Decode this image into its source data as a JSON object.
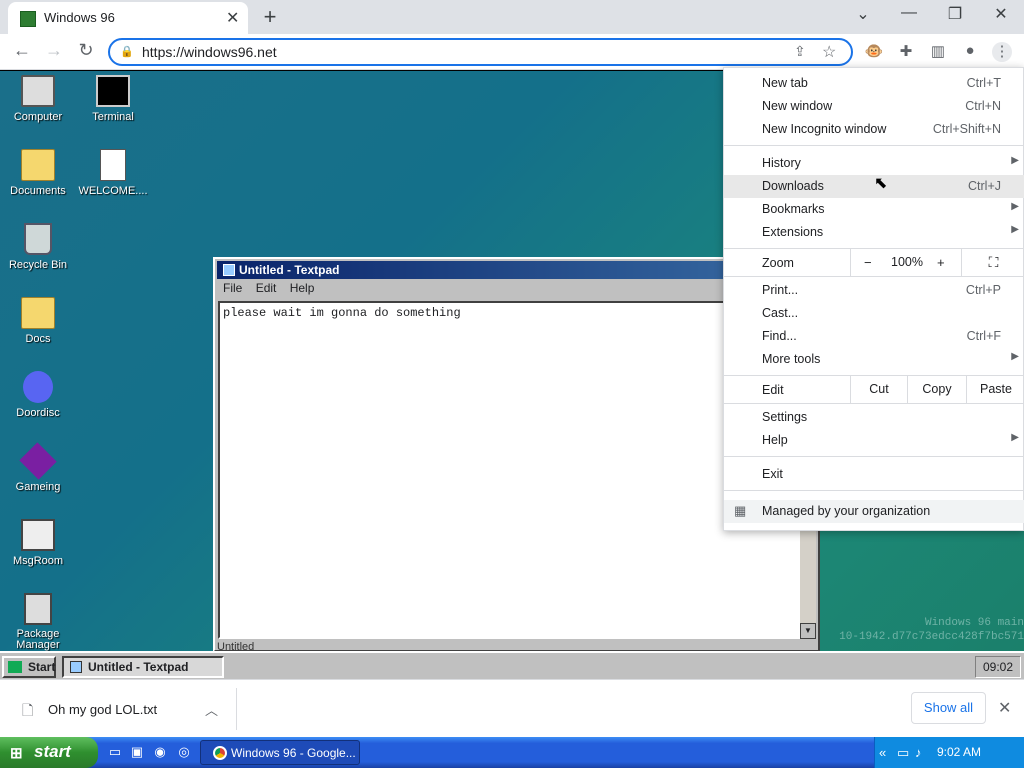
{
  "browser": {
    "tab_title": "Windows 96",
    "tab_close": "✕",
    "new_tab": "+",
    "window_controls": {
      "dropdown": "⌄",
      "minimize": "—",
      "restore": "❐",
      "close": "✕"
    },
    "url": "https://windows96.net",
    "icons": [
      "back-icon",
      "forward-icon",
      "reload-icon",
      "lock-icon",
      "share-icon",
      "star-icon",
      "extension-monkey-icon",
      "puzzle-icon",
      "sidepanel-icon",
      "profile-icon",
      "kebab-menu-icon"
    ]
  },
  "chrome_menu": {
    "new_tab": {
      "label": "New tab",
      "shortcut": "Ctrl+T"
    },
    "new_window": {
      "label": "New window",
      "shortcut": "Ctrl+N"
    },
    "new_incognito": {
      "label": "New Incognito window",
      "shortcut": "Ctrl+Shift+N"
    },
    "history": {
      "label": "History"
    },
    "downloads": {
      "label": "Downloads",
      "shortcut": "Ctrl+J"
    },
    "bookmarks": {
      "label": "Bookmarks"
    },
    "extensions": {
      "label": "Extensions"
    },
    "zoom": {
      "label": "Zoom",
      "minus": "−",
      "value": "100%",
      "plus": "+"
    },
    "print": {
      "label": "Print...",
      "shortcut": "Ctrl+P"
    },
    "cast": {
      "label": "Cast..."
    },
    "find": {
      "label": "Find...",
      "shortcut": "Ctrl+F"
    },
    "more_tools": {
      "label": "More tools"
    },
    "edit": {
      "label": "Edit",
      "cut": "Cut",
      "copy": "Copy",
      "paste": "Paste"
    },
    "settings": {
      "label": "Settings"
    },
    "help": {
      "label": "Help"
    },
    "exit": {
      "label": "Exit"
    },
    "managed": {
      "label": "Managed by your organization"
    }
  },
  "desktop": {
    "icons": [
      {
        "label": "Computer",
        "icon": "computer-icon"
      },
      {
        "label": "Terminal",
        "icon": "terminal-icon"
      },
      {
        "label": "Documents",
        "icon": "documents-folder-icon"
      },
      {
        "label": "WELCOME....",
        "icon": "markdown-file-icon"
      },
      {
        "label": "Recycle Bin",
        "icon": "recycle-bin-icon"
      },
      {
        "label": "Docs",
        "icon": "folder-icon"
      },
      {
        "label": "Doordisc",
        "icon": "doordisc-icon"
      },
      {
        "label": "Gameing",
        "icon": "cube-icon"
      },
      {
        "label": "MsgRoom",
        "icon": "msgroom-icon"
      },
      {
        "label": "Package Manager",
        "icon": "package-icon"
      }
    ],
    "watermark_line1": "Windows 96 main",
    "watermark_line2": "10-1942.d77c73edcc428f7bc571"
  },
  "textpad": {
    "title": "Untitled - Textpad",
    "menu": [
      "File",
      "Edit",
      "Help"
    ],
    "content": "please wait im gonna do something",
    "status": "Untitled"
  },
  "w96_taskbar": {
    "start": "Start",
    "task": "Untitled - Textpad",
    "clock": "09:02"
  },
  "download_bar": {
    "file_name": "Oh my god LOL.txt",
    "show_all": "Show all"
  },
  "xp_taskbar": {
    "start": "start",
    "window": "Windows 96 - Google...",
    "clock": "9:02 AM"
  }
}
